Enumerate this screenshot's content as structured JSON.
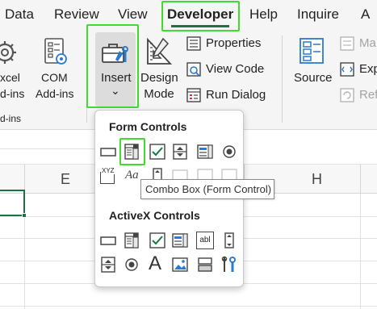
{
  "tabs": [
    "Data",
    "Review",
    "View",
    "Developer",
    "Help",
    "Inquire",
    "A"
  ],
  "ribbon": {
    "addins_group": {
      "excel_addins": [
        "xcel",
        "d-ins"
      ],
      "com_addins": [
        "COM",
        "Add-ins"
      ],
      "group_label": "d-ins"
    },
    "controls_group": {
      "insert_label": "Insert",
      "insert_chevron": "⌄",
      "design_mode": [
        "Design",
        "Mode"
      ],
      "properties": "Properties",
      "view_code": "View Code",
      "run_dialog": "Run Dialog"
    },
    "xml_group": {
      "source": "Source",
      "map_properties": "Ma",
      "expansion_packs": "Exp",
      "refresh_data": "Ref"
    }
  },
  "sheet": {
    "column_headers": [
      "E",
      "H"
    ]
  },
  "dropdown": {
    "form_controls_title": "Form Controls",
    "activex_controls_title": "ActiveX Controls",
    "form_controls": [
      "button",
      "combo-box",
      "check-box",
      "spin-button",
      "list-box",
      "option-button",
      "label",
      "group-box",
      "scroll-bar",
      "text-field",
      "combo-list-edit",
      "combo-drop-down-edit"
    ],
    "label_sample": "Aa",
    "label_superscript": "XYZ",
    "activex_controls": [
      "command-button",
      "combo-box",
      "check-box",
      "list-box",
      "text-box",
      "scroll-bar",
      "spin-button",
      "option-button",
      "label",
      "image",
      "toggle-button",
      "more-controls"
    ],
    "activex_label_glyph": "A",
    "text_box_glyph": "abl",
    "tooltip": "Combo Box (Form Control)"
  },
  "colors": {
    "highlight": "#3ddc2f",
    "excel_green": "#1e7145",
    "icon_blue": "#2b79d0",
    "icon_green": "#107c41"
  }
}
